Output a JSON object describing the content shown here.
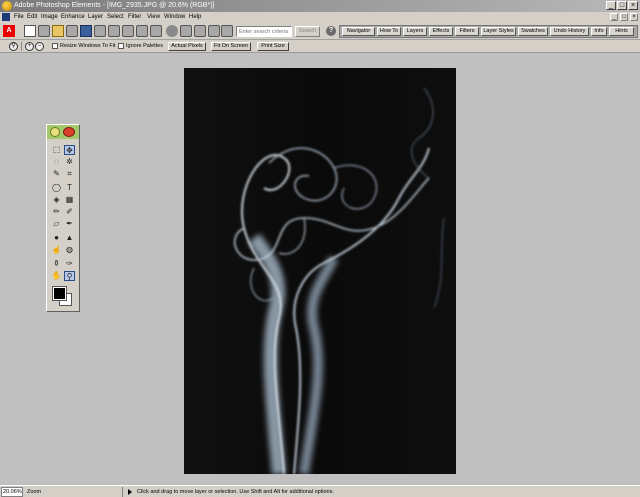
{
  "window": {
    "title": "Adobe Photoshop Elements - [IMG_2935.JPG @ 20.6% (RGB*)]",
    "controls": [
      "_",
      "□",
      "×"
    ]
  },
  "menu": [
    "File",
    "Edit",
    "Image",
    "Enhance",
    "Layer",
    "Select",
    "Filter",
    "View",
    "Window",
    "Help"
  ],
  "shortcuts": {
    "search_placeholder": "Enter search criteria",
    "search_button": "Search",
    "help_label": "?"
  },
  "palette_tabs": [
    "Navigator",
    "How To",
    "Layers",
    "Effects",
    "Filters",
    "Layer Styles",
    "Swatches",
    "Undo History",
    "Info",
    "Hints"
  ],
  "options": {
    "resize_windows": "Resize Windows To Fit",
    "ignore_palettes": "Ignore Palettes",
    "actual_pixels": "Actual Pixels",
    "fit_on_screen": "Fit On Screen",
    "print_size": "Print Size"
  },
  "status": {
    "zoom": "20.06%",
    "zoom_label": "Zoom",
    "hint": "Click and drag to move layer or selection.  Use Shift and Alt for additional options."
  },
  "colors": {
    "foreground": "#000000",
    "background": "#ffffff",
    "toolbox_header": "#a4c96b"
  }
}
